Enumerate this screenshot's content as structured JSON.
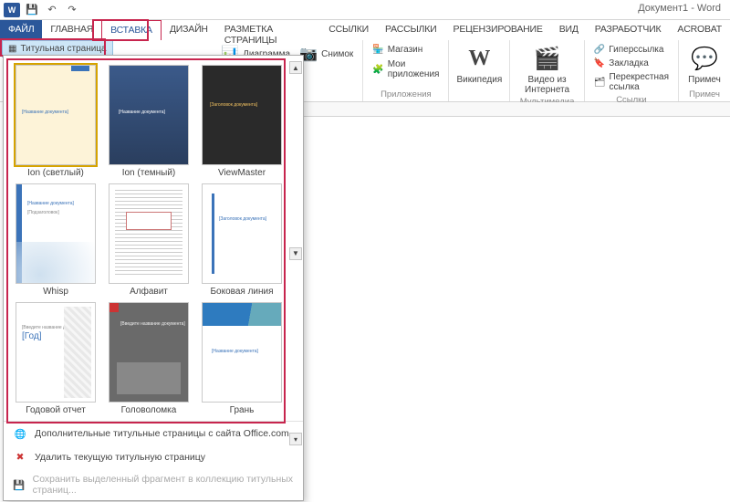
{
  "app": {
    "doc_title": "Документ1 - Word",
    "app_icon_text": "W"
  },
  "qat": {
    "save": "💾",
    "undo": "↶",
    "redo": "↷"
  },
  "tabs": {
    "file": "ФАЙЛ",
    "home": "ГЛАВНАЯ",
    "insert": "ВСТАВКА",
    "design": "ДИЗАЙН",
    "layout": "РАЗМЕТКА СТРАНИЦЫ",
    "refs": "ССЫЛКИ",
    "mail": "РАССЫЛКИ",
    "review": "РЕЦЕНЗИРОВАНИЕ",
    "view": "ВИД",
    "dev": "РАЗРАБОТЧИК",
    "acrobat": "ACROBAT"
  },
  "ribbon": {
    "cover_page": "Титульная страница",
    "chart": "Диаграмма",
    "screenshot": "Снимок",
    "store": "Магазин",
    "myapps": "Мои приложения",
    "apps_group": "Приложения",
    "wikipedia": "Википедия",
    "online_video": "Видео из Интернета",
    "media_group": "Мультимедиа",
    "hyperlink": "Гиперссылка",
    "bookmark": "Закладка",
    "crossref": "Перекрестная ссылка",
    "links_group": "Ссылки",
    "comment": "Примеч",
    "comment_group": "Примеч"
  },
  "gallery": {
    "items": [
      {
        "label": "Ion (светлый)",
        "text": "[Название документа]"
      },
      {
        "label": "Ion (темный)",
        "text": "[Название документа]"
      },
      {
        "label": "ViewMaster",
        "text": "[Заголовок документа]"
      },
      {
        "label": "Whisp",
        "text": "[Название документа]"
      },
      {
        "label": "Алфавит",
        "text": ""
      },
      {
        "label": "Боковая линия",
        "text": "[Заголовок документа]"
      },
      {
        "label": "Годовой отчет",
        "text": "[Год]"
      },
      {
        "label": "Головоломка",
        "text": "[Введите название документа]"
      },
      {
        "label": "Грань",
        "text": "[Название документа]"
      }
    ],
    "more": "Дополнительные титульные страницы с сайта Office.com",
    "remove": "Удалить текущую титульную страницу",
    "save_sel": "Сохранить выделенный фрагмент в коллекцию титульных страниц..."
  },
  "thumb_extra": {
    "whisp_sub": "[Подзаголовок]",
    "year_label": "[Введите название документа]"
  }
}
